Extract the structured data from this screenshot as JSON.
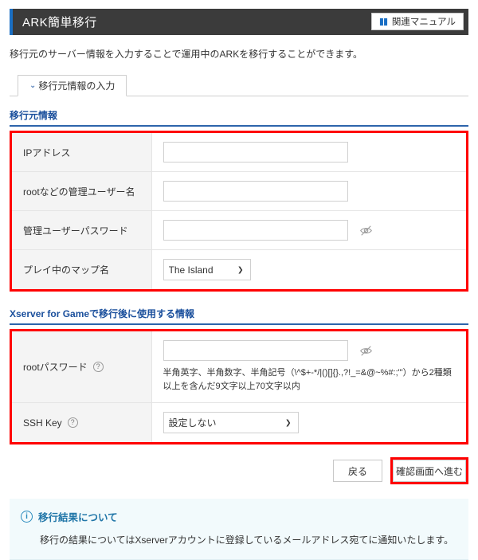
{
  "header": {
    "title": "ARK簡単移行",
    "manual_button": "関連マニュアル",
    "manual_icon": "book-icon",
    "accent_color": "#1a6fc4",
    "bar_color": "#3b3b3b"
  },
  "intro": "移行元のサーバー情報を入力することで運用中のARKを移行することができます。",
  "tab": {
    "label": "移行元情報の入力",
    "chevron": "⌄"
  },
  "sections": [
    {
      "heading": "移行元情報",
      "highlight_color": "#ff0000",
      "rows": [
        {
          "label": "IPアドレス",
          "help": false,
          "control": "text",
          "value": "",
          "placeholder": ""
        },
        {
          "label": "rootなどの管理ユーザー名",
          "help": false,
          "control": "text",
          "value": "",
          "placeholder": ""
        },
        {
          "label": "管理ユーザーパスワード",
          "help": false,
          "control": "password",
          "value": "",
          "placeholder": "",
          "toggle_icon": "eye-slash-icon"
        },
        {
          "label": "プレイ中のマップ名",
          "help": false,
          "control": "select",
          "value": "The Island",
          "options": [
            "The Island"
          ]
        }
      ]
    },
    {
      "heading": "Xserver for Gameで移行後に使用する情報",
      "highlight_color": "#ff0000",
      "rows": [
        {
          "label": "rootパスワード",
          "help": true,
          "help_icon": "question-circle-icon",
          "control": "password",
          "value": "",
          "placeholder": "",
          "toggle_icon": "eye-slash-icon",
          "hint": "半角英字、半角数字、半角記号（\\^$+-*/|()[]{}.,?!_=&@~%#:;\"'）から2種類以上を含んだ9文字以上70文字以内"
        },
        {
          "label": "SSH Key",
          "help": true,
          "help_icon": "question-circle-icon",
          "control": "select",
          "value": "設定しない",
          "options": [
            "設定しない"
          ]
        }
      ]
    }
  ],
  "buttons": {
    "back": "戻る",
    "next": "確認画面へ進む",
    "next_highlight_color": "#ff0000"
  },
  "info": {
    "icon": "info-circle-icon",
    "title": "移行結果について",
    "body": "移行の結果についてはXserverアカウントに登録しているメールアドレス宛てに通知いたします。"
  }
}
